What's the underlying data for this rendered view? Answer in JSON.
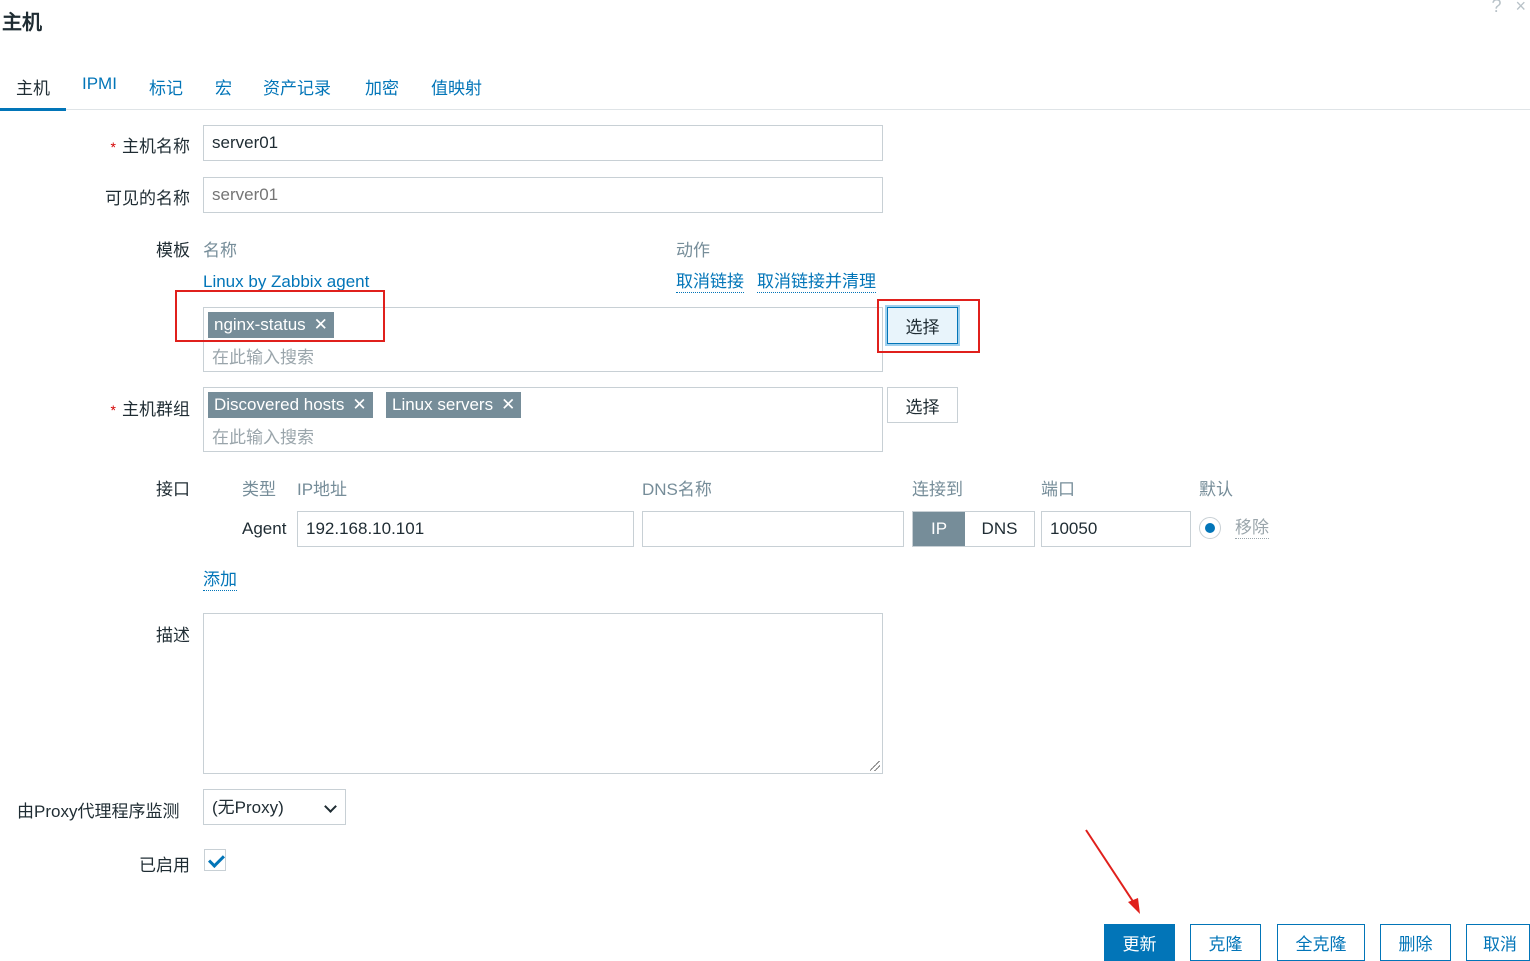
{
  "dialog": {
    "title": "主机",
    "help_icon": "?",
    "close_icon": "×"
  },
  "tabs": [
    {
      "label": "主机",
      "active": true
    },
    {
      "label": "IPMI"
    },
    {
      "label": "标记"
    },
    {
      "label": "宏"
    },
    {
      "label": "资产记录"
    },
    {
      "label": "加密"
    },
    {
      "label": "值映射"
    }
  ],
  "form": {
    "host_name": {
      "label": "主机名称",
      "value": "server01"
    },
    "visible_name": {
      "label": "可见的名称",
      "placeholder": "server01"
    },
    "templates": {
      "label": "模板",
      "col_name": "名称",
      "col_action": "动作",
      "linked": {
        "name": "Linux by Zabbix agent",
        "unlink": "取消链接",
        "unlink_clear": "取消链接并清理"
      },
      "chips": [
        "nginx-status"
      ],
      "placeholder": "在此输入搜索",
      "select_label": "选择"
    },
    "host_groups": {
      "label": "主机群组",
      "chips": [
        "Discovered hosts",
        "Linux servers"
      ],
      "placeholder": "在此输入搜索",
      "select_label": "选择"
    },
    "interfaces": {
      "label": "接口",
      "col_type": "类型",
      "col_ip": "IP地址",
      "col_dns": "DNS名称",
      "col_connect": "连接到",
      "col_port": "端口",
      "col_default": "默认",
      "row": {
        "type": "Agent",
        "ip": "192.168.10.101",
        "dns": "",
        "connect_ip": "IP",
        "connect_dns": "DNS",
        "port": "10050",
        "remove": "移除"
      },
      "add": "添加"
    },
    "description": {
      "label": "描述",
      "value": ""
    },
    "proxy": {
      "label": "由Proxy代理程序监测",
      "value": "(无Proxy)"
    },
    "enabled": {
      "label": "已启用",
      "checked": true
    }
  },
  "footer": {
    "update": "更新",
    "clone": "克隆",
    "full_clone": "全克隆",
    "delete": "删除",
    "cancel": "取消"
  }
}
